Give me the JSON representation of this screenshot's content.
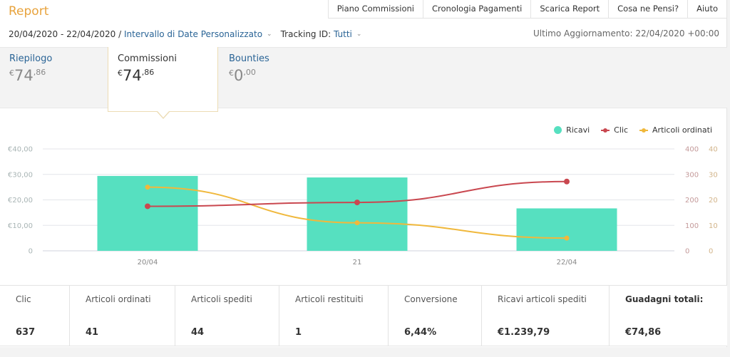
{
  "header": {
    "title": "Report",
    "nav": [
      "Piano Commissioni",
      "Cronologia Pagamenti",
      "Scarica Report",
      "Cosa ne Pensi?",
      "Aiuto"
    ],
    "date_range": "20/04/2020 - 22/04/2020 /",
    "range_type": "Intervallo di Date Personalizzato",
    "tracking_label": "Tracking ID:",
    "tracking_value": "Tutti",
    "last_update": "Ultimo Aggiornamento: 22/04/2020 +00:00",
    "chevron_icon": "chevron-down-icon"
  },
  "tabs": [
    {
      "label": "Riepilogo",
      "currency": "€",
      "int": "74",
      "dec": ",86",
      "active": false
    },
    {
      "label": "Commissioni",
      "currency": "€",
      "int": "74",
      "dec": ",86",
      "active": true
    },
    {
      "label": "Bounties",
      "currency": "€",
      "int": "0",
      "dec": ",00",
      "active": false
    }
  ],
  "colors": {
    "ricavi": "#56e0c0",
    "clic": "#c9474f",
    "articoli": "#f0b83c",
    "accent": "#e8a33d",
    "link": "#2a6496"
  },
  "chart_data": {
    "type": "bar",
    "categories": [
      "20/04",
      "21",
      "22/04"
    ],
    "series": [
      {
        "name": "Ricavi",
        "type": "bar",
        "axis": "left",
        "values": [
          29.4,
          28.8,
          16.66
        ]
      },
      {
        "name": "Clic",
        "type": "line",
        "axis": "right1",
        "values": [
          175,
          190,
          272
        ]
      },
      {
        "name": "Articoli ordinati",
        "type": "line",
        "axis": "right2",
        "values": [
          25,
          11,
          5
        ]
      }
    ],
    "left_axis": {
      "ticks": [
        "0",
        "€10,00",
        "€20,00",
        "€30,00",
        "€40,00"
      ],
      "range": [
        0,
        40
      ]
    },
    "right_axis_1": {
      "ticks": [
        "0",
        "100",
        "200",
        "300",
        "400"
      ],
      "range": [
        0,
        400
      ]
    },
    "right_axis_2": {
      "ticks": [
        "0",
        "10",
        "20",
        "30",
        "40"
      ],
      "range": [
        0,
        40
      ]
    },
    "legend": [
      "Ricavi",
      "Clic",
      "Articoli ordinati"
    ],
    "legend_position": "top-right",
    "grid": true,
    "title": "",
    "xlabel": "",
    "ylabel": ""
  },
  "stats": [
    {
      "label": "Clic",
      "value": "637"
    },
    {
      "label": "Articoli ordinati",
      "value": "41"
    },
    {
      "label": "Articoli spediti",
      "value": "44"
    },
    {
      "label": "Articoli restituiti",
      "value": "1"
    },
    {
      "label": "Conversione",
      "value": "6,44%"
    },
    {
      "label": "Ricavi articoli spediti",
      "value": "€1.239,79"
    },
    {
      "label": "Guadagni totali:",
      "value": "€74,86"
    }
  ]
}
